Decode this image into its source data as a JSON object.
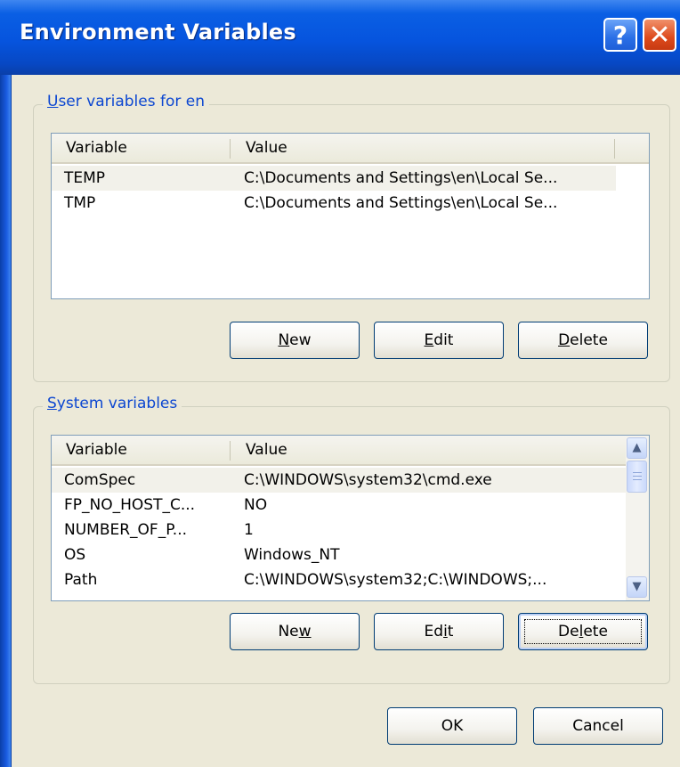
{
  "window": {
    "title": "Environment Variables",
    "help_glyph": "?",
    "close_glyph": "✕"
  },
  "user_group": {
    "title": "User variables for en",
    "columns": [
      "Variable",
      "Value"
    ],
    "rows": [
      {
        "variable": "TEMP",
        "value": "C:\\Documents and Settings\\en\\Local Se..."
      },
      {
        "variable": "TMP",
        "value": "C:\\Documents and Settings\\en\\Local Se..."
      }
    ],
    "buttons": {
      "new": "New",
      "edit": "Edit",
      "delete": "Delete"
    }
  },
  "system_group": {
    "title": "System variables",
    "columns": [
      "Variable",
      "Value"
    ],
    "rows": [
      {
        "variable": "ComSpec",
        "value": "C:\\WINDOWS\\system32\\cmd.exe"
      },
      {
        "variable": "FP_NO_HOST_C...",
        "value": "NO"
      },
      {
        "variable": "NUMBER_OF_P...",
        "value": "1"
      },
      {
        "variable": "OS",
        "value": "Windows_NT"
      },
      {
        "variable": "Path",
        "value": "C:\\WINDOWS\\system32;C:\\WINDOWS;..."
      }
    ],
    "buttons": {
      "new": "New",
      "edit": "Edit",
      "delete": "Delete"
    }
  },
  "footer": {
    "ok": "OK",
    "cancel": "Cancel"
  },
  "colors": {
    "title_bar": "#0654de",
    "group_title": "#0b46d1",
    "dialog_bg": "#ece9d8"
  },
  "icons": {
    "help": "help-icon",
    "close": "close-icon",
    "scroll_up": "scroll-up-icon",
    "scroll_down": "scroll-down-icon"
  }
}
